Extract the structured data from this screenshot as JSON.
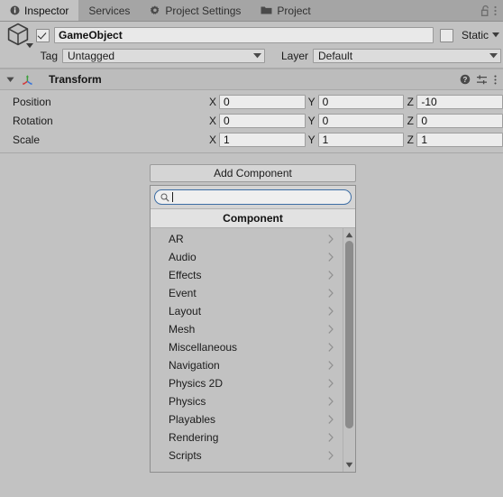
{
  "window": {
    "tabs": [
      {
        "label": "Inspector",
        "icon": "info-circle-icon",
        "active": true
      },
      {
        "label": "Services",
        "icon": "",
        "active": false
      },
      {
        "label": "Project Settings",
        "icon": "gear-icon",
        "active": false
      },
      {
        "label": "Project",
        "icon": "folder-icon",
        "active": false
      }
    ],
    "right_icons": [
      {
        "name": "lock-open-icon"
      },
      {
        "name": "more-vertical-icon"
      }
    ]
  },
  "object_header": {
    "icon": "cube-icon",
    "enabled_checkbox": true,
    "name": "GameObject",
    "static_label": "Static",
    "static_checked": false,
    "tag_label": "Tag",
    "tag_value": "Untagged",
    "layer_label": "Layer",
    "layer_value": "Default"
  },
  "transform": {
    "title": "Transform",
    "icon": "transform-axes-icon",
    "expanded": true,
    "header_icons": [
      {
        "name": "help-icon"
      },
      {
        "name": "preset-icon"
      },
      {
        "name": "more-vertical-icon"
      }
    ],
    "rows": [
      {
        "label": "Position",
        "x": "0",
        "y": "0",
        "z": "-10"
      },
      {
        "label": "Rotation",
        "x": "0",
        "y": "0",
        "z": "0"
      },
      {
        "label": "Scale",
        "x": "1",
        "y": "1",
        "z": "1"
      }
    ],
    "axis_labels": {
      "x": "X",
      "y": "Y",
      "z": "Z"
    }
  },
  "add_component": {
    "button_label": "Add Component",
    "search_value": "",
    "search_placeholder": "",
    "search_icon": "search-icon",
    "popup_title": "Component",
    "items": [
      {
        "label": "AR"
      },
      {
        "label": "Audio"
      },
      {
        "label": "Effects"
      },
      {
        "label": "Event"
      },
      {
        "label": "Layout"
      },
      {
        "label": "Mesh"
      },
      {
        "label": "Miscellaneous"
      },
      {
        "label": "Navigation"
      },
      {
        "label": "Physics 2D"
      },
      {
        "label": "Physics"
      },
      {
        "label": "Playables"
      },
      {
        "label": "Rendering"
      },
      {
        "label": "Scripts"
      }
    ],
    "scrollbar": {
      "up": "scroll-up-arrow",
      "down": "scroll-down-arrow"
    }
  },
  "colors": {
    "window_bg": "#c2c2c2",
    "tabbar_bg": "#a5a5a5",
    "field_bg": "#ececec",
    "search_border": "#3d6ea5",
    "axis_x": "#d33b3b",
    "axis_y": "#4caf50",
    "axis_z": "#3a76d8"
  }
}
